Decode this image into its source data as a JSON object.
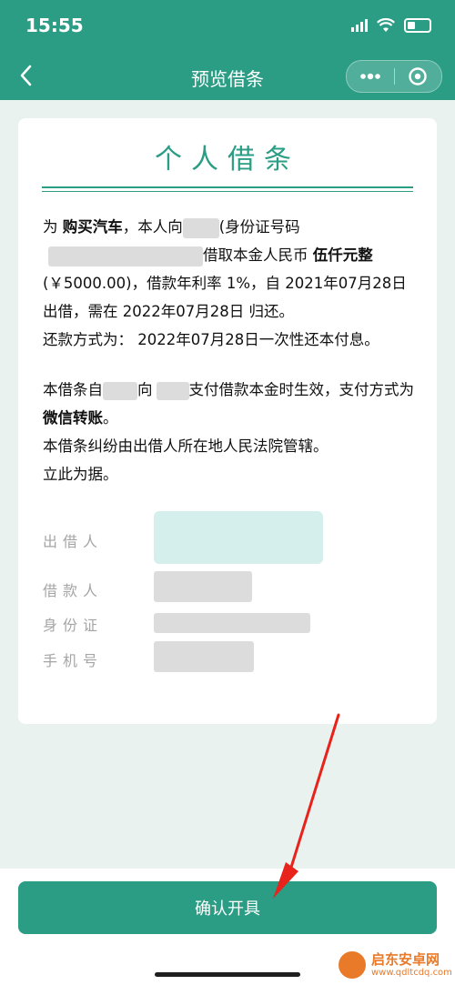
{
  "status_bar": {
    "time": "15:55"
  },
  "nav": {
    "title": "预览借条"
  },
  "document": {
    "title": "个人借条",
    "para1": {
      "t1": "为 ",
      "purpose": "购买汽车",
      "t2": "，本人向",
      "t3": "(身份证号码",
      "t4": "借取本金人民币 ",
      "amount_cn": "伍仟元整",
      "amount": "(￥5000.00)",
      "t5": "，借款年利率 1%，自 2021年07月28日 出借，需在 2022年07月28日 归还。",
      "t6": "还款方式为： 2022年07月28日一次性还本付息。"
    },
    "para2": {
      "t1": "本借条自",
      "t2": "向",
      "t3": "支付借款本金时生效，支付方式为 ",
      "method": "微信转账",
      "t4": "。",
      "line2": "本借条纠纷由出借人所在地人民法院管辖。",
      "line3": "立此为据。"
    },
    "parties": {
      "lender_label": "出借人",
      "borrower_label": "借款人",
      "id_label": "身份证",
      "phone_label": "手机号"
    }
  },
  "footer": {
    "confirm_label": "确认开具"
  },
  "watermark": {
    "name": "启东安卓网",
    "url": "www.qdltcdq.com"
  },
  "colors": {
    "brand": "#2a9d84",
    "annotation_arrow": "#e8231b"
  }
}
